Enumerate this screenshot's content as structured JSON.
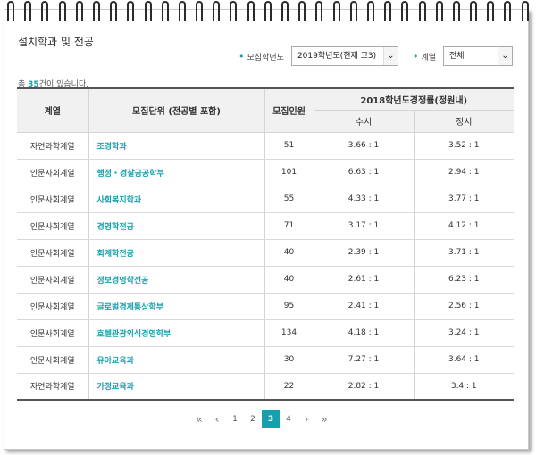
{
  "header": {
    "title": "설치학과 및 전공"
  },
  "filters": {
    "year_label": "모집학년도",
    "year_value": "2019학년도(현재 고3)",
    "division_label": "계열",
    "division_value": "전체"
  },
  "summary": {
    "prefix": "총 ",
    "count": "35",
    "suffix": "건이 있습니다."
  },
  "table": {
    "headers": {
      "affiliation": "계열",
      "unit": "모집단위 (전공별 포함)",
      "quota": "모집인원",
      "rate_group": "2018학년도경쟁률(정원내)",
      "rate_early": "수시",
      "rate_regular": "정시"
    },
    "rows": [
      {
        "affiliation": "자연과학계열",
        "unit": "조경학과",
        "quota": "51",
        "early": "3.66 : 1",
        "regular": "3.52 : 1"
      },
      {
        "affiliation": "인문사회계열",
        "unit": "행정・경찰공공학부",
        "quota": "101",
        "early": "6.63 : 1",
        "regular": "2.94 : 1"
      },
      {
        "affiliation": "인문사회계열",
        "unit": "사회복지학과",
        "quota": "55",
        "early": "4.33 : 1",
        "regular": "3.77 : 1"
      },
      {
        "affiliation": "인문사회계열",
        "unit": "경영학전공",
        "quota": "71",
        "early": "3.17 : 1",
        "regular": "4.12 : 1"
      },
      {
        "affiliation": "인문사회계열",
        "unit": "회계학전공",
        "quota": "40",
        "early": "2.39 : 1",
        "regular": "3.71 : 1"
      },
      {
        "affiliation": "인문사회계열",
        "unit": "정보경영학전공",
        "quota": "40",
        "early": "2.61 : 1",
        "regular": "6.23 : 1"
      },
      {
        "affiliation": "인문사회계열",
        "unit": "글로벌경제통상학부",
        "quota": "95",
        "early": "2.41 : 1",
        "regular": "2.56 : 1"
      },
      {
        "affiliation": "인문사회계열",
        "unit": "호텔관광외식경영학부",
        "quota": "134",
        "early": "4.18 : 1",
        "regular": "3.24 : 1"
      },
      {
        "affiliation": "인문사회계열",
        "unit": "유아교육과",
        "quota": "30",
        "early": "7.27 : 1",
        "regular": "3.64 : 1"
      },
      {
        "affiliation": "자연과학계열",
        "unit": "가정교육과",
        "quota": "22",
        "early": "2.82 : 1",
        "regular": "3.4 : 1"
      }
    ]
  },
  "pagination": {
    "first": "«",
    "prev": "‹",
    "next": "›",
    "last": "»",
    "pages": [
      "1",
      "2",
      "3",
      "4"
    ],
    "current": "3"
  },
  "colors": {
    "accent": "#16a0ad"
  }
}
